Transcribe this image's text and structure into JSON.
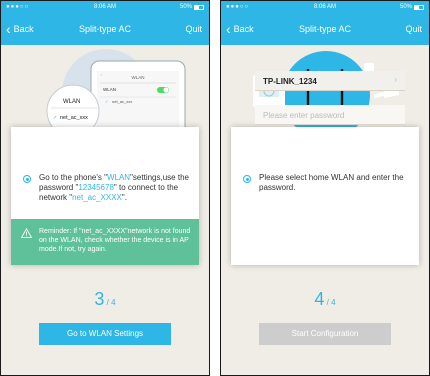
{
  "status_bar": {
    "signal": "●●●○○",
    "time": "8:06 AM",
    "battery": "50%"
  },
  "screens": [
    {
      "nav": {
        "back_label": "Back",
        "title": "Split-type AC",
        "quit_label": "Quit"
      },
      "illustration": {
        "wlan_bubble": "WLAN",
        "network_name": "net_ac_xxx",
        "phone_header": "WLAN",
        "phone_item": "net_ac_xxx"
      },
      "instruction": {
        "part1": "Go to the phone's \"",
        "wlan_highlight": "WLAN",
        "part2": "\"settings,use the password \"",
        "password_highlight": "12345678",
        "part3": "\" to connect to the network \"",
        "network_highlight": "net_ac_XXXX",
        "part4": "\"."
      },
      "reminder": "Reminder: If \"net_ac_XXXX\"network is not found on the WLAN, check whether the device is in AP mode.If not, try again.",
      "step": {
        "current": "3",
        "total": "4"
      },
      "button_label": "Go to WLAN Settings"
    },
    {
      "nav": {
        "back_label": "Back",
        "title": "Split-type AC",
        "quit_label": "Quit"
      },
      "instruction": "Please select home WLAN and enter the password.",
      "ssid_value": "TP-LINK_1234",
      "password_placeholder": "Please enter password",
      "step": {
        "current": "4",
        "total": "4"
      },
      "button_label": "Start Configuration"
    }
  ],
  "colors": {
    "accent": "#2eb7e6",
    "reminder_bg": "#5ec19a",
    "disabled_button": "#cdcdcd",
    "background": "#f0ede6"
  }
}
